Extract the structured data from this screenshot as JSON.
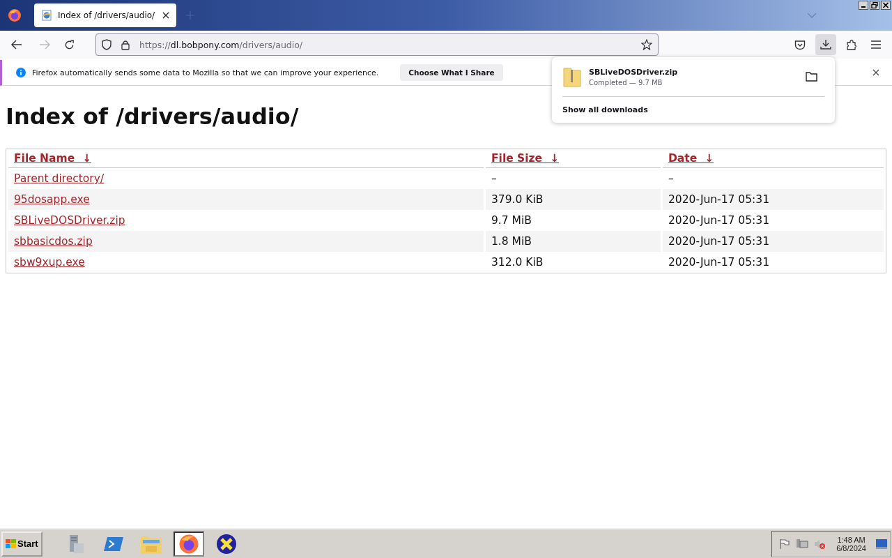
{
  "tabs": [
    {
      "title": "Index of /drivers/audio/",
      "selected": true
    }
  ],
  "address": {
    "scheme": "https://",
    "host": "dl.bobpony.com",
    "path": "/drivers/audio/"
  },
  "notification": {
    "message": "Firefox automatically sends some data to Mozilla so that we can improve your experience.",
    "button": "Choose What I Share"
  },
  "downloads_panel": {
    "items": [
      {
        "filename": "SBLiveDOSDriver.zip",
        "status": "Completed — 9.7 MB"
      }
    ],
    "show_all": "Show all downloads"
  },
  "page": {
    "heading": "Index of /drivers/audio/",
    "columns": [
      {
        "label": "File Name",
        "sort": "↓"
      },
      {
        "label": "File Size",
        "sort": "↓"
      },
      {
        "label": "Date",
        "sort": "↓"
      }
    ],
    "rows": [
      {
        "name": "Parent directory/",
        "size": "–",
        "date": "–"
      },
      {
        "name": "95dosapp.exe",
        "size": "379.0 KiB",
        "date": "2020-Jun-17 05:31"
      },
      {
        "name": "SBLiveDOSDriver.zip",
        "size": "9.7 MiB",
        "date": "2020-Jun-17 05:31"
      },
      {
        "name": "sbbasicdos.zip",
        "size": "1.8 MiB",
        "date": "2020-Jun-17 05:31"
      },
      {
        "name": "sbw9xup.exe",
        "size": "312.0 KiB",
        "date": "2020-Jun-17 05:31"
      }
    ]
  },
  "taskbar": {
    "start": "Start",
    "apps": [
      {
        "kind": "server",
        "selected": false
      },
      {
        "kind": "powershell",
        "selected": false
      },
      {
        "kind": "explorer",
        "selected": false
      },
      {
        "kind": "firefox",
        "selected": true
      },
      {
        "kind": "x-app",
        "selected": false
      }
    ],
    "clock": {
      "time": "1:48 AM",
      "date": "6/8/2024"
    }
  }
}
